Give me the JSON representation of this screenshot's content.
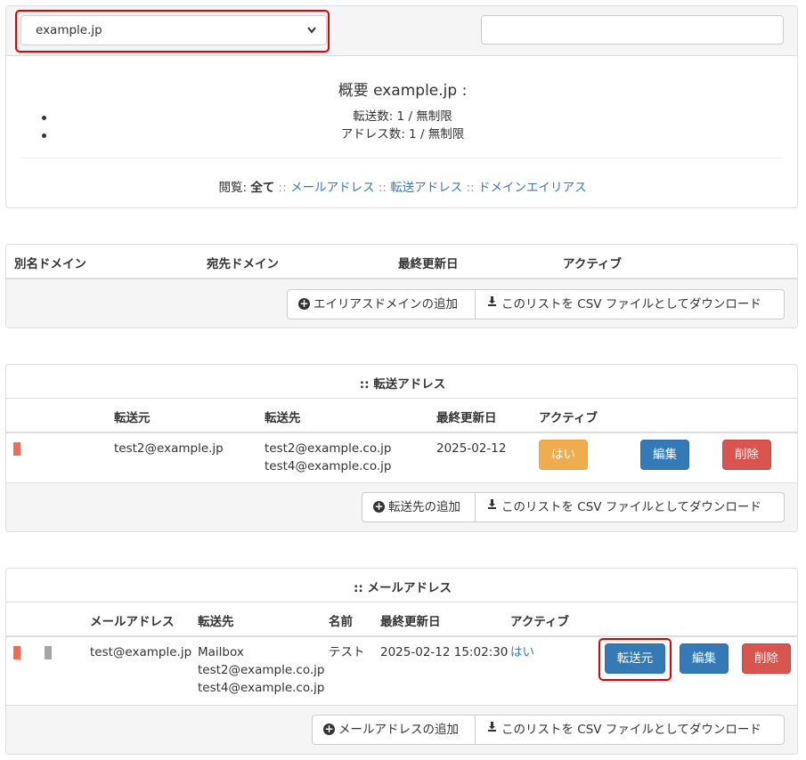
{
  "domain_select": {
    "value": "example.jp"
  },
  "summary": {
    "title": "概要 example.jp :",
    "forward_count": "転送数: 1 / 無制限",
    "address_count": "アドレス数: 1 / 無制限"
  },
  "browse": {
    "label": "閲覧:",
    "all": "全て",
    "sep": "::",
    "links": [
      "メールアドレス",
      "転送アドレス",
      "ドメインエイリアス"
    ]
  },
  "alias_domains": {
    "columns": [
      "別名ドメイン",
      "宛先ドメイン",
      "最終更新日",
      "アクティブ"
    ],
    "add_label": "エイリアスドメインの追加",
    "csv_label": "このリストを CSV ファイルとしてダウンロード"
  },
  "forwards": {
    "caption": ":: 転送アドレス",
    "columns": [
      "転送元",
      "転送先",
      "最終更新日",
      "アクティブ"
    ],
    "rows": [
      {
        "from": "test2@example.jp",
        "to": [
          "test2@example.co.jp",
          "test4@example.co.jp"
        ],
        "updated": "2025-02-12",
        "active": "はい",
        "edit": "編集",
        "delete": "削除"
      }
    ],
    "add_label": "転送先の追加",
    "csv_label": "このリストを CSV ファイルとしてダウンロード"
  },
  "mailboxes": {
    "caption": ":: メールアドレス",
    "columns": [
      "メールアドレス",
      "転送先",
      "名前",
      "最終更新日",
      "アクティブ"
    ],
    "rows": [
      {
        "address": "test@example.jp",
        "to": [
          "Mailbox",
          "test2@example.co.jp",
          "test4@example.co.jp"
        ],
        "name": "テスト",
        "updated": "2025-02-12 15:02:30",
        "active": "はい",
        "forward_src": "転送元",
        "edit": "編集",
        "delete": "削除"
      }
    ],
    "add_label": "メールアドレスの追加",
    "csv_label": "このリストを CSV ファイルとしてダウンロード"
  },
  "colors": {
    "link": "#337ab7",
    "warning": "#f0ad4e",
    "primary": "#337ab7",
    "danger": "#d9534f",
    "highlight": "#e00000",
    "status_red": "#f66a53",
    "status_gray": "#a6a6a6"
  }
}
